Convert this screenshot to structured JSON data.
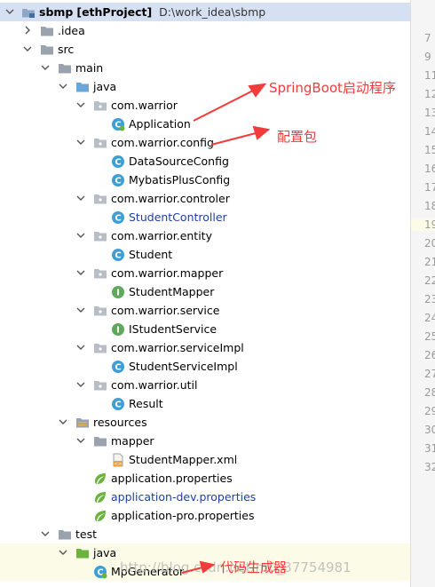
{
  "project": {
    "name": "sbmp",
    "module": "[ethProject]",
    "path": "D:\\work_idea\\sbmp"
  },
  "tree": {
    "idea": ".idea",
    "src": "src",
    "main": "main",
    "java": "java",
    "pkg_warrior": "com.warrior",
    "application": "Application",
    "pkg_config": "com.warrior.config",
    "datasource_config": "DataSourceConfig",
    "mybatisplus_config": "MybatisPlusConfig",
    "pkg_controler": "com.warrior.controler",
    "student_controller": "StudentController",
    "pkg_entity": "com.warrior.entity",
    "student": "Student",
    "pkg_mapper": "com.warrior.mapper",
    "student_mapper": "StudentMapper",
    "pkg_service": "com.warrior.service",
    "istudent_service": "IStudentService",
    "pkg_serviceimpl": "com.warrior.serviceImpl",
    "student_service_impl": "StudentServiceImpl",
    "pkg_util": "com.warrior.util",
    "result": "Result",
    "resources": "resources",
    "mapper_folder": "mapper",
    "student_mapper_xml": "StudentMapper.xml",
    "app_props": "application.properties",
    "app_dev_props": "application-dev.properties",
    "app_pro_props": "application-pro.properties",
    "test": "test",
    "test_java": "java",
    "mp_generator": "MpGenerator"
  },
  "gutter_lines": [
    "7",
    "9",
    "11",
    "12",
    "13",
    "14",
    "15",
    "16",
    "17",
    "18",
    "19",
    "20",
    "21",
    "22",
    "23",
    "24",
    "25",
    "26",
    "27",
    "28",
    "29",
    "30",
    "31",
    "32"
  ],
  "annotations": {
    "springboot": "SpringBoot启动程序",
    "config": "配置包",
    "generator": "代码生成器"
  },
  "watermark": "http://blog.csdn.net/m0_37754981",
  "colors": {
    "annotation_red": "#f23b3b",
    "selection": "#d5e1f2",
    "package_link_blue": "#1f3fa3",
    "class_icon": "#3d9fd6",
    "interface_icon": "#60a85b",
    "spring_icon": "#6cb33e",
    "folder_grey": "#9aa3ad",
    "folder_blue": "#6aa6d8"
  },
  "icons": [
    "chevron-down-icon",
    "chevron-right-icon",
    "module-folder-icon",
    "folder-icon",
    "source-folder-icon",
    "resources-folder-icon",
    "package-icon",
    "class-icon",
    "interface-icon",
    "spring-boot-class-icon",
    "xml-file-icon",
    "spring-properties-icon"
  ]
}
